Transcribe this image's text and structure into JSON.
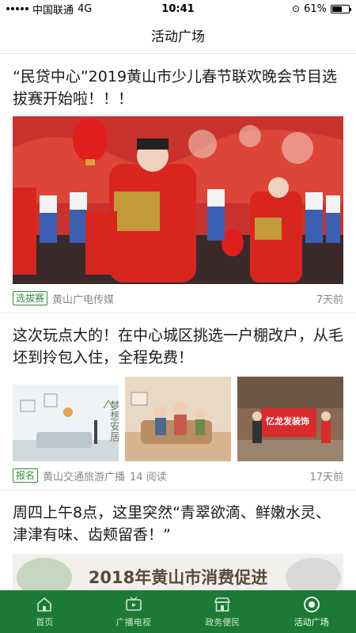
{
  "status_bar": {
    "carrier": "中国联通",
    "network": "4G",
    "time": "10:41",
    "battery": "61%",
    "battery_level": 0.61
  },
  "nav": {
    "title": "活动广场"
  },
  "articles": [
    {
      "title": "“民贷中心”2019黄山市少儿春节联欢晚会节目选拔赛开始啦！！！",
      "tag": "选拔赛",
      "source": "黄山广电传媒",
      "time": "7天前"
    },
    {
      "title": "这次玩点大的！在中心城区挑选一户棚改户，从毛坯到拎包入住，全程免费！",
      "tag": "报名",
      "source": "黄山交通旅游广播",
      "reads": "14 阅读",
      "time": "17天前",
      "images": {
        "img1_text": "梦想安居",
        "img3_text": "忆龙发装饰"
      }
    },
    {
      "title": "周四上午8点，这里突然“青翠欲滴、鲜嫩水灵、津津有味、齿颊留香！”",
      "banner_text": "2018年黄山市消费促进"
    }
  ],
  "tabs": [
    {
      "label": "首页",
      "icon": "home-icon"
    },
    {
      "label": "广播电视",
      "icon": "tv-icon"
    },
    {
      "label": "政务便民",
      "icon": "shop-icon"
    },
    {
      "label": "活动广场",
      "icon": "activity-icon",
      "active": true
    }
  ],
  "colors": {
    "brand_green": "#1d7a34",
    "tag_green": "#2f8a3e"
  }
}
